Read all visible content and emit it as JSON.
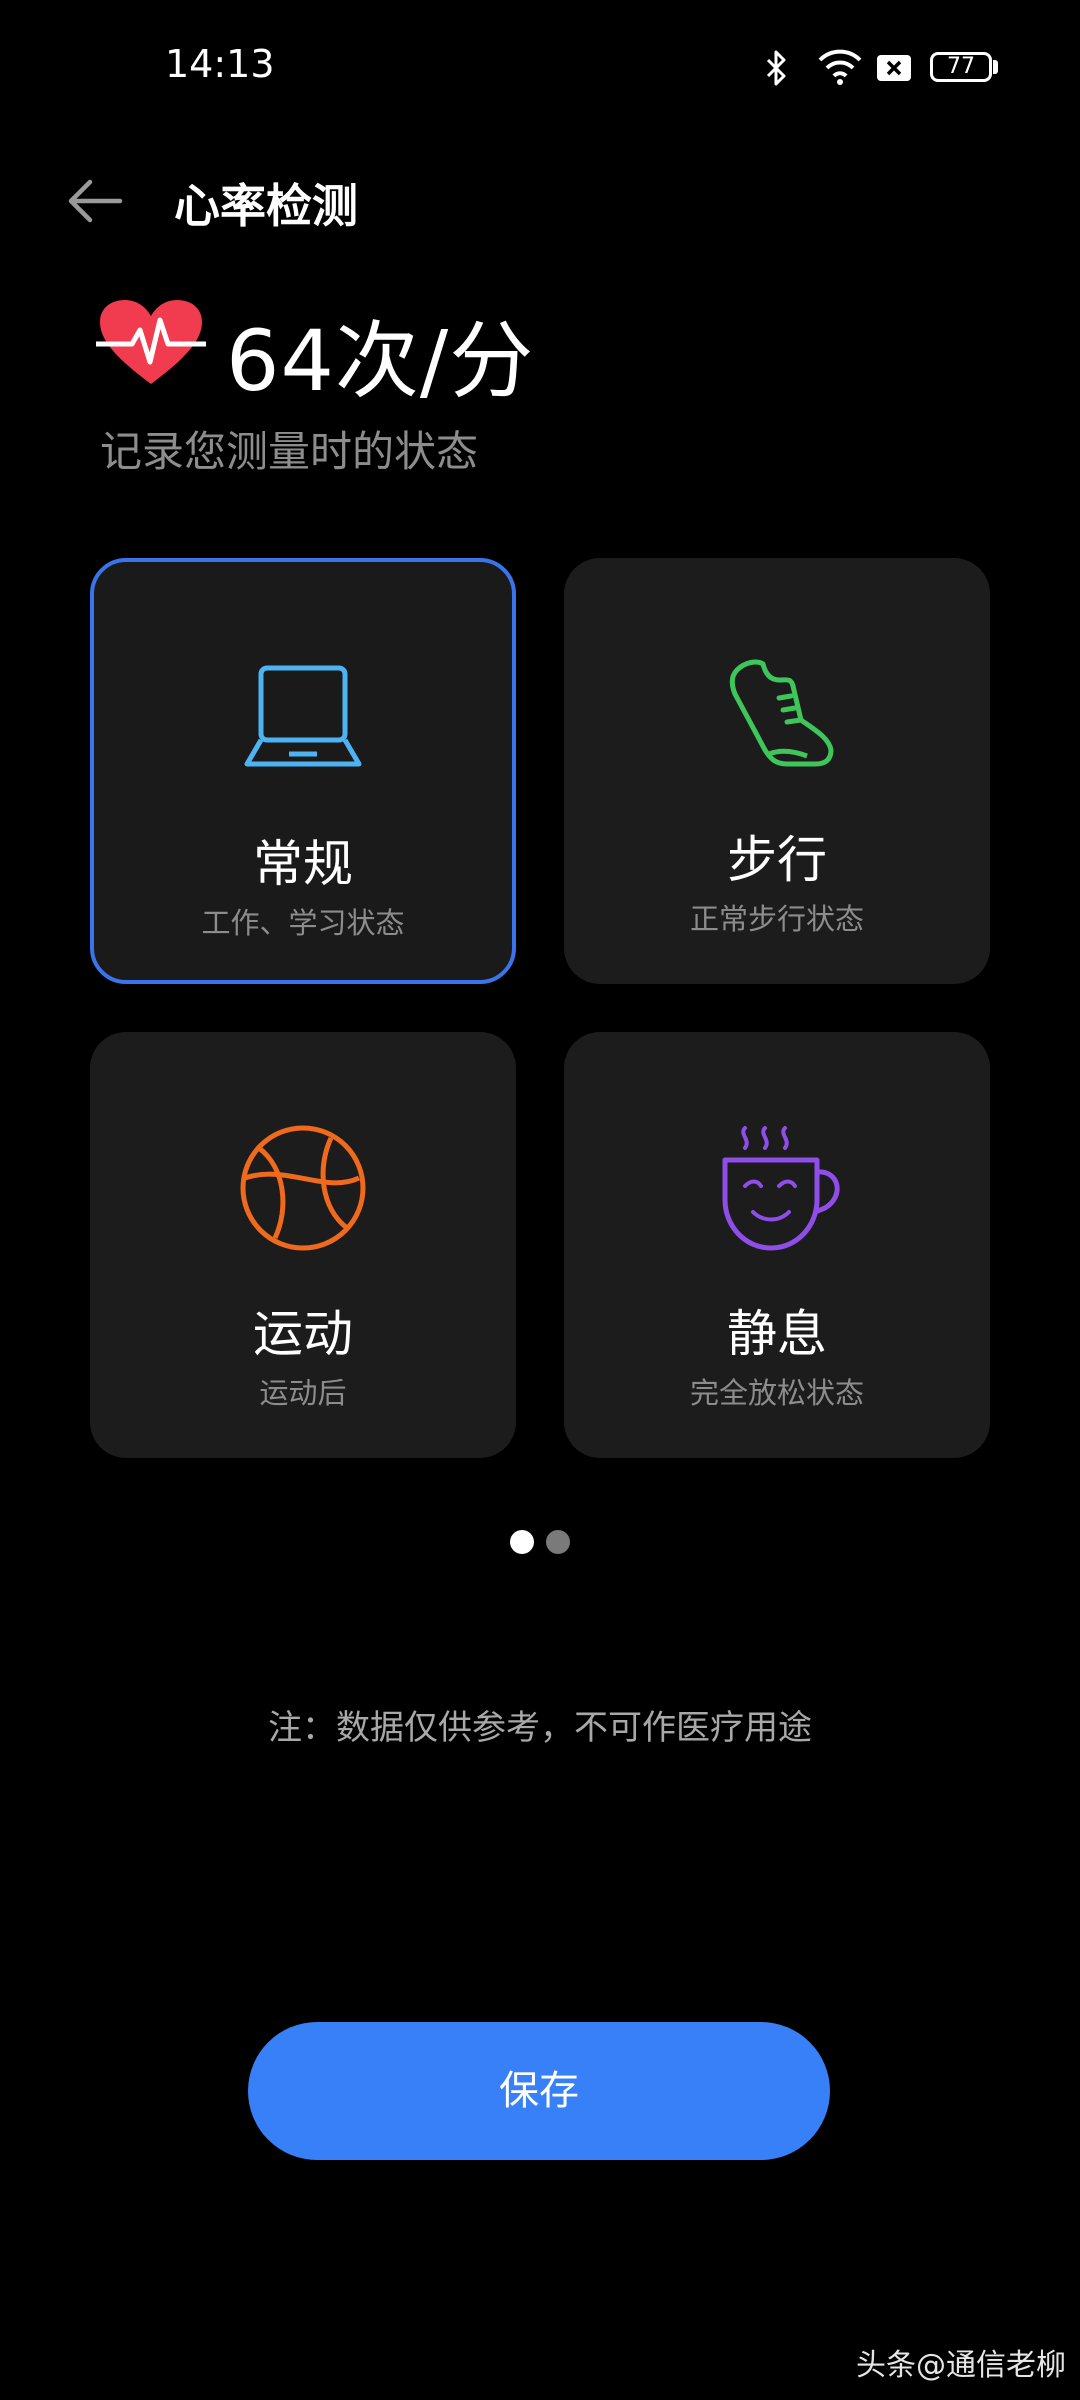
{
  "status_bar": {
    "time": "14:13",
    "battery": "77"
  },
  "header": {
    "title": "心率检测"
  },
  "heart_rate": {
    "value_text": "64次/分",
    "subtitle": "记录您测量时的状态"
  },
  "states": [
    {
      "label": "常规",
      "desc": "工作、学习状态",
      "icon": "laptop-icon",
      "color": "#4db3f2",
      "selected": true
    },
    {
      "label": "步行",
      "desc": "正常步行状态",
      "icon": "shoe-icon",
      "color": "#3fc65a",
      "selected": false
    },
    {
      "label": "运动",
      "desc": "运动后",
      "icon": "basketball-icon",
      "color": "#f06a1e",
      "selected": false
    },
    {
      "label": "静息",
      "desc": "完全放松状态",
      "icon": "coffee-cup-icon",
      "color": "#8f4ee8",
      "selected": false
    }
  ],
  "pager": {
    "pages": 2,
    "current": 1
  },
  "note": "注：数据仅供参考，不可作医疗用途",
  "save_button": "保存",
  "watermark": "头条@通信老柳",
  "colors": {
    "accent": "#3880f7",
    "heart": "#f03c4e"
  }
}
